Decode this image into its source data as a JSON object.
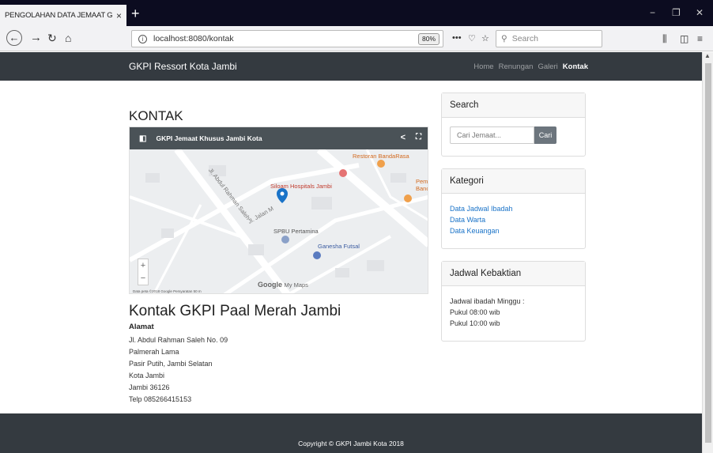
{
  "browser": {
    "tab_title": "PENGOLAHAN DATA JEMAAT GKPI",
    "tab_close": "×",
    "new_tab": "+",
    "url": "localhost:8080/kontak",
    "zoom": "80%",
    "search_placeholder": "Search"
  },
  "navbar": {
    "brand": "GKPI Ressort Kota Jambi",
    "links": [
      {
        "label": "Home",
        "active": false
      },
      {
        "label": "Renungan",
        "active": false
      },
      {
        "label": "Galeri",
        "active": false
      },
      {
        "label": "Kontak",
        "active": true
      }
    ]
  },
  "main": {
    "heading": "KONTAK",
    "map": {
      "title": "GKPI Jemaat Khusus Jambi Kota",
      "labels": {
        "restoran": "Restoran BandaRasa",
        "siloam": "Siloam Hospitals Jambi",
        "spbu": "SPBU Pertamina",
        "ganesha": "Ganesha Futsal",
        "road1": "Jl. Abdul Rahman Saleh",
        "road2": "Jl. Jalan M",
        "pem": "Pem Banc",
        "google": "Google",
        "mymaps": "My Maps",
        "footer": "Data peta ©2018 Google   Persyaratan   50 m"
      },
      "zoom_in": "+",
      "zoom_out": "−"
    },
    "contact_heading": "Kontak GKPI Paal Merah Jambi",
    "address_label": "Alamat",
    "address_lines": [
      "Jl. Abdul Rahman Saleh No. 09",
      "Palmerah Lama",
      "Pasir Putih, Jambi Selatan",
      "Kota Jambi",
      "Jambi 36126",
      "Telp 085266415153"
    ]
  },
  "sidebar": {
    "search": {
      "title": "Search",
      "placeholder": "Cari Jemaat...",
      "button": "Cari"
    },
    "kategori": {
      "title": "Kategori",
      "links": [
        "Data Jadwal Ibadah",
        "Data Warta",
        "Data Keuangan"
      ]
    },
    "jadwal": {
      "title": "Jadwal Kebaktian",
      "lines": [
        "Jadwal ibadah Minggu :",
        "Pukul 08:00 wib",
        "Pukul 10:00 wib"
      ]
    }
  },
  "footer": {
    "copyright": "Copyright © GKPI Jambi Kota 2018"
  }
}
